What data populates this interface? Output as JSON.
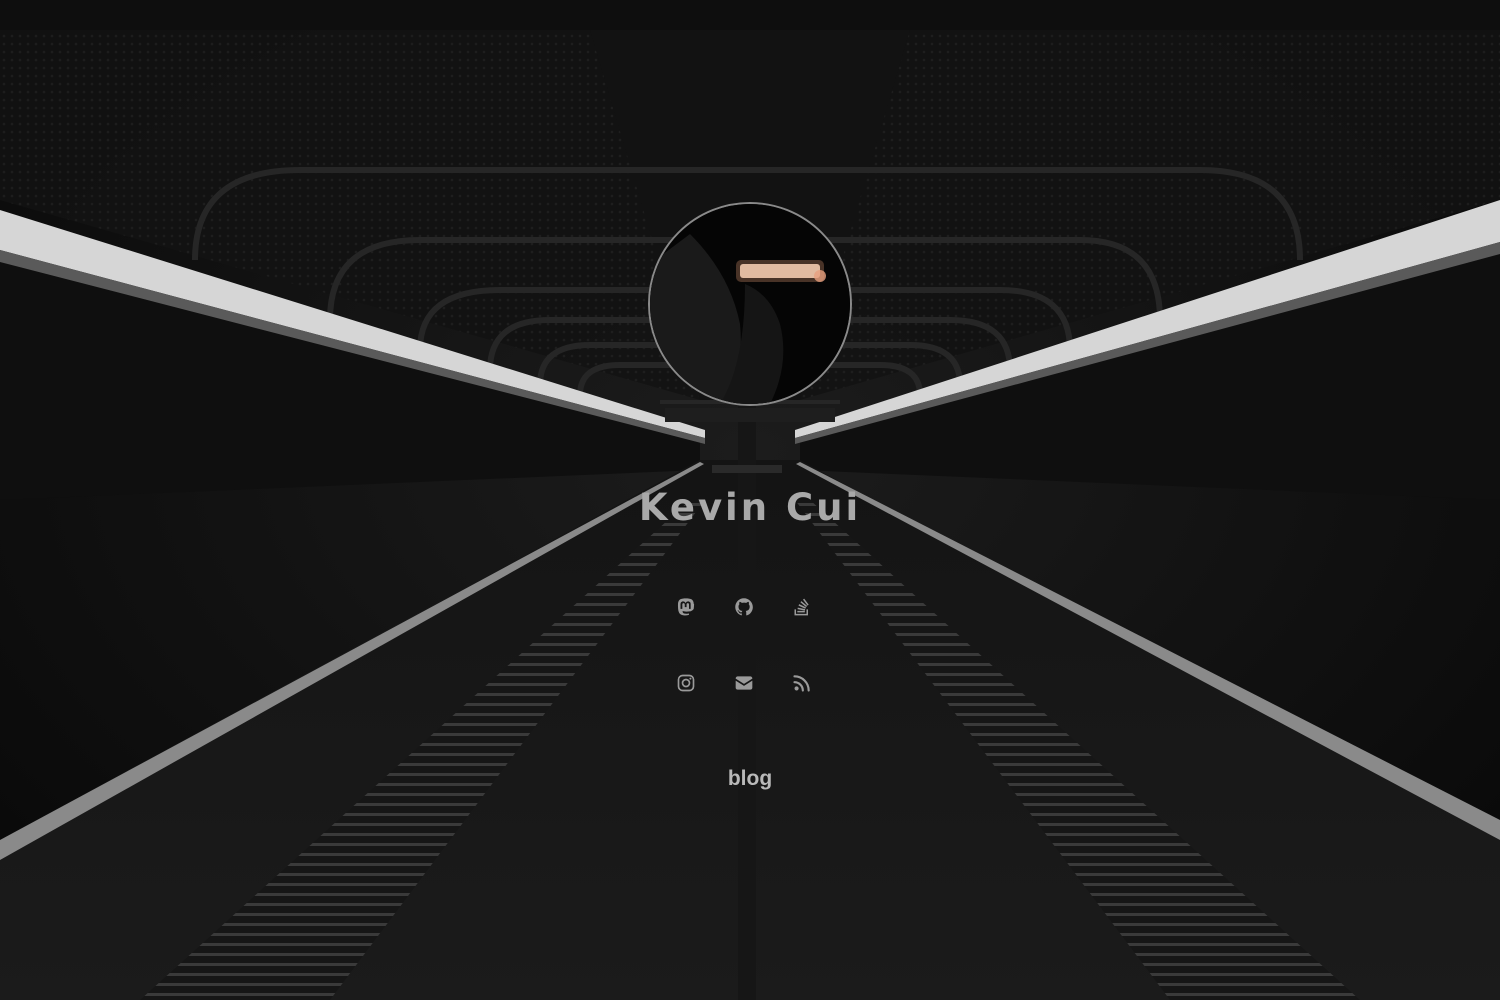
{
  "profile": {
    "name": "Kevin Cui"
  },
  "social_links": [
    {
      "icon": "mastodon-icon"
    },
    {
      "icon": "github-icon"
    },
    {
      "icon": "stackoverflow-icon"
    },
    {
      "icon": "instagram-icon"
    },
    {
      "icon": "email-icon"
    },
    {
      "icon": "rss-icon"
    }
  ],
  "nav": {
    "blog_label": "blog"
  },
  "colors": {
    "icon": "#9a9a9a",
    "text": "#a9a9a9",
    "background": "#0c0c0c",
    "light_strip": "#d8d8d8"
  }
}
